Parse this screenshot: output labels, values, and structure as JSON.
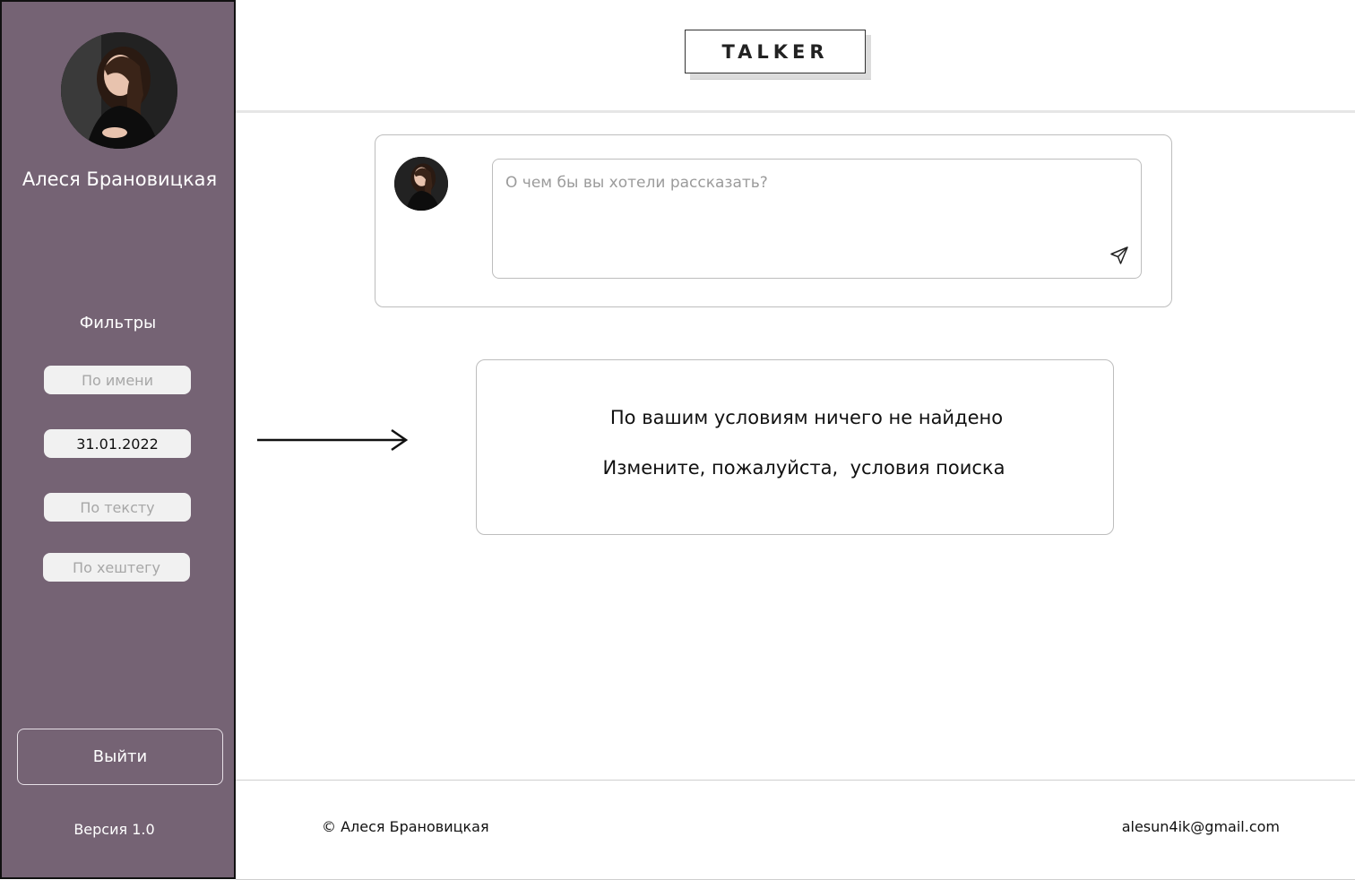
{
  "header": {
    "logo_text": "TALKER"
  },
  "sidebar": {
    "profile_name": "Алеся Брановицкая",
    "filters_title": "Фильтры",
    "filters": [
      {
        "placeholder": "По имени",
        "value": ""
      },
      {
        "placeholder": "",
        "value": "31.01.2022"
      },
      {
        "placeholder": "По тексту",
        "value": ""
      },
      {
        "placeholder": "По хештегу",
        "value": ""
      }
    ],
    "logout_label": "Выйти",
    "version": "Версия 1.0",
    "background_color": "#756374"
  },
  "composer": {
    "placeholder": "О чем бы вы хотели рассказать?",
    "send_icon": "paper-plane-icon"
  },
  "empty_state": {
    "line1": "По вашим условиям ничего не найдено",
    "line2": "Измените, пожалуйста,  условия поиска"
  },
  "footer": {
    "copyright": "© Алеся Брановицкая",
    "email": "alesun4ik@gmail.com"
  }
}
